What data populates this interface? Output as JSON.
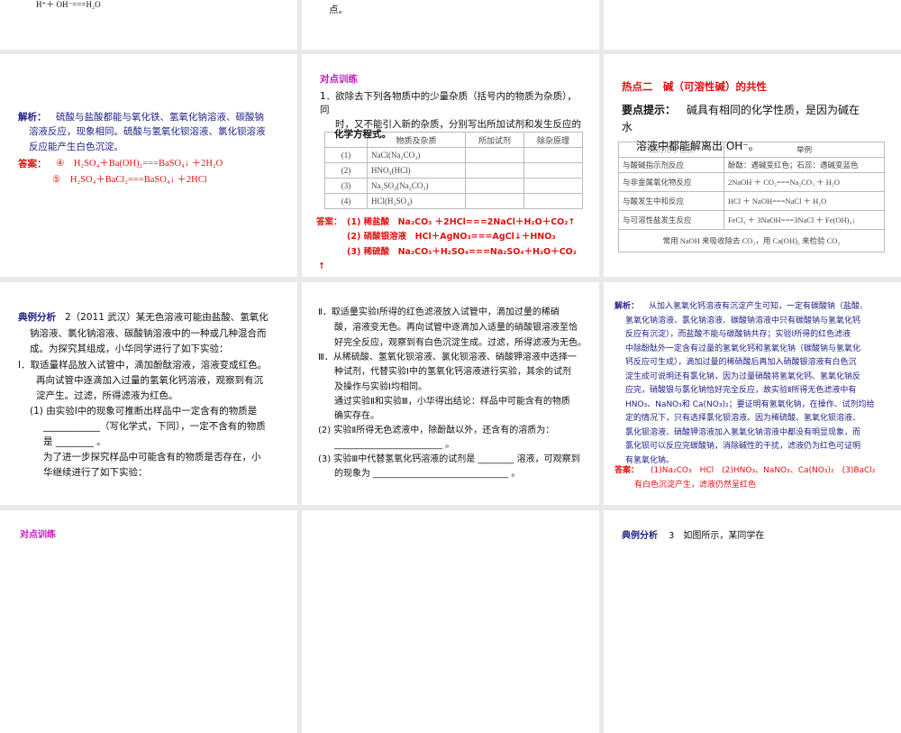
{
  "slides": {
    "s1": {
      "formula": "H⁺＋ OH⁻===H₂O"
    },
    "s2": {
      "text": "点。"
    },
    "s4": {
      "label": "解析：",
      "lines": [
        "硫酸与盐酸都能与氧化铁、氢氧化钠溶液、碳酸钠",
        "溶液反应，现象相同。硫酸与氢氧化钡溶液、氯化钡溶液",
        "反应能产生白色沉淀。"
      ],
      "answer_label": "答案：",
      "answers": [
        "④　H₂SO₄＋Ba(OH)₂===BaSO₄↓ ＋2H₂O",
        "⑤　H₂SO₄＋BaCl₂===BaSO₄↓ ＋2HCl"
      ]
    },
    "s5": {
      "heading": "对点训练",
      "q": [
        "1．欲除去下列各物质中的少量杂质（括号内的物质为杂质），",
        "同",
        "时，又不能引入新的杂质，分别写出所加试剂和发生反应的",
        "化学方程式。"
      ],
      "table": {
        "headers": [
          "",
          "物质及杂质",
          "所加试剂",
          "除杂原理"
        ],
        "rows": [
          [
            "(1)",
            "NaCl(Na₂CO₃)"
          ],
          [
            "(2)",
            "HNO₃(HCl)"
          ],
          [
            "(3)",
            "Na₂SO₄(Na₂CO₃)"
          ],
          [
            "(4)",
            "HCl(H₂SO₄)"
          ]
        ]
      },
      "answer_label": "答案：",
      "answers": [
        "(1) 稀盐酸　Na₂CO₃ ＋2HCl===2NaCl＋H₂O＋CO₂↑",
        "(2) 硝酸银溶液　HCl＋AgNO₃===AgCl↓＋HNO₃",
        "(3) 稀硫酸　Na₂CO₃＋H₂SO₄===Na₂SO₄＋H₂O＋CO₂",
        "↑"
      ]
    },
    "s6": {
      "heading": "热点二　碱（可溶性碱）的共性",
      "tip_label": "要点提示：",
      "tip": [
        "碱具有相同的化学性质，是因为碱在",
        "水",
        "溶液中都能解离出 OH⁻。"
      ],
      "table": {
        "headers": [
          "碱的化学性质",
          "举例"
        ],
        "rows": [
          [
            "与酸碱指示剂反应",
            "酚酞：遇碱变红色；石蕊：遇碱变蓝色"
          ],
          [
            "与非金属氧化物反应",
            "2NaOH ＋ CO₂===Na₂CO₃ ＋ H₂O"
          ],
          [
            "与酸发生中和反应",
            "HCl ＋ NaOH===NaCl ＋ H₂O"
          ],
          [
            "与可溶性盐发生反应",
            "FeCl₃ ＋ 3NaOH===3NaCl ＋ Fe(OH)₃↓"
          ]
        ],
        "footer": "常用 NaOH 来吸收除去 CO₂，用 Ca(OH)₂ 来检验 CO₂"
      }
    },
    "s7": {
      "label": "典例分析",
      "lines": [
        "2（2011 武汉）某无色溶液可能由盐酸、氢氧化",
        "钠溶液、氯化钠溶液、碳酸钠溶液中的一种或几种混合而",
        "成。为探究其组成，小华同学进行了如下实验：",
        "Ⅰ．取适量样品放入试管中，滴加酚酞溶液，溶液变成红色。",
        "再向试管中逐滴加入过量的氢氧化钙溶液，观察到有沉",
        "淀产生。过滤，所得滤液为红色。",
        "(1) 由实验Ⅰ中的现象可推断出样品中一定含有的物质是",
        "____________（写化学式，下同），一定不含有的物质",
        "是 ________ 。",
        "为了进一步探究样品中可能含有的物质是否存在，小",
        "华继续进行了如下实验："
      ]
    },
    "s8": {
      "lines": [
        "Ⅱ．取适量实验Ⅰ所得的红色滤液放入试管中，滴加过量的稀硝",
        "酸，溶液变无色。再向试管中逐滴加入适量的硝酸银溶液至恰",
        "好完全反应，观察到有白色沉淀生成。过滤，所得滤液为无色。",
        "Ⅲ．从稀硫酸、氢氧化钡溶液、氯化钡溶液、硝酸钾溶液中选择一",
        "种试剂，代替实验Ⅰ中的氢氧化钙溶液进行实验，其余的试剂",
        "及操作与实验Ⅰ均相同。",
        "通过实验Ⅱ和实验Ⅲ，小华得出结论：样品中可能含有的物质",
        "确实存在。",
        "(2) 实验Ⅱ所得无色滤液中，除酚酞以外，还含有的溶质为：",
        "________________________ 。",
        "(3) 实验Ⅲ中代替氢氧化钙溶液的试剂是 ________ 溶液，可观察到",
        "的现象为 ______________________________ 。"
      ]
    },
    "s9": {
      "label": "解析：",
      "lines": [
        "从加入氢氧化钙溶液有沉淀产生可知，一定有碳酸钠（盐酸、",
        "氢氧化钠溶液、氯化钠溶液、碳酸钠溶液中只有碳酸钠与氢氧化钙",
        "反应有沉淀），而盐酸不能与碳酸钠共存；实验Ⅰ所得的红色滤液",
        "中除酚酞外一定含有过量的氢氧化钙和氢氧化钠（碳酸钠与氢氧化",
        "钙反应可生成），滴加过量的稀硝酸后再加入硝酸银溶液有白色沉",
        "淀生成可说明还有氯化钠，因为过量硝酸将氢氧化钙、氢氧化钠反",
        "应完，硝酸银与氯化钠恰好完全反应，故实验Ⅱ所得无色滤液中有",
        "HNO₃、NaNO₃和 Ca(NO₃)₂；要证明有氢氧化钠，在操作、试剂均给",
        "定的情况下，只有选择氯化钡溶液。因为稀硫酸、氢氧化钡溶液、",
        "氯化钡溶液、硝酸钾溶液加入氢氧化钠溶液中都没有明显现象，而",
        "氯化钡可以反应完碳酸钠，消除碱性的干扰，滤液仍为红色可证明",
        "有氢氧化钠。"
      ],
      "answer_label": "答案：",
      "answers": [
        "(1)Na₂CO₃　HCl　(2)HNO₃、NaNO₃、Ca(NO₃)₂　(3)BaCl₂",
        "有白色沉淀产生，滤液仍然呈红色"
      ]
    },
    "s10": {
      "heading": "对点训练"
    },
    "s12": {
      "label": "典例分析",
      "text": "3　如图所示，某同学在"
    }
  }
}
